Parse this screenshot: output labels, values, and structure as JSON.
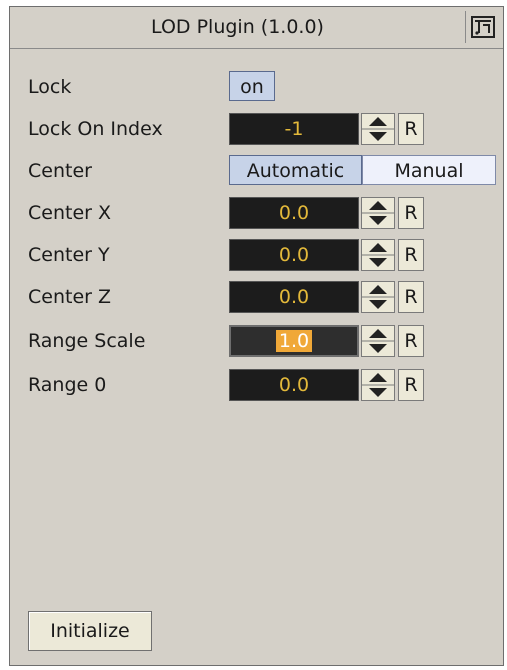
{
  "title": "LOD Plugin (1.0.0)",
  "title_icon": "plugin-logo-icon",
  "rows": {
    "lock": {
      "label": "Lock",
      "toggle": "on"
    },
    "lock_on_index": {
      "label": "Lock On Index",
      "value": "-1",
      "reset": "R"
    },
    "center": {
      "label": "Center",
      "options": [
        "Automatic",
        "Manual"
      ],
      "selected": "Automatic"
    },
    "center_x": {
      "label": "Center X",
      "value": "0.0",
      "reset": "R"
    },
    "center_y": {
      "label": "Center Y",
      "value": "0.0",
      "reset": "R"
    },
    "center_z": {
      "label": "Center Z",
      "value": "0.0",
      "reset": "R"
    },
    "range_scale": {
      "label": "Range Scale",
      "value": "1.0",
      "reset": "R"
    },
    "range_0": {
      "label": "Range 0",
      "value": "0.0",
      "reset": "R"
    }
  },
  "initialize_label": "Initialize",
  "colors": {
    "panel_bg": "#d4d0c8",
    "field_bg": "#1c1c1c",
    "field_text": "#e3b93a",
    "selection": "#f0a838"
  }
}
